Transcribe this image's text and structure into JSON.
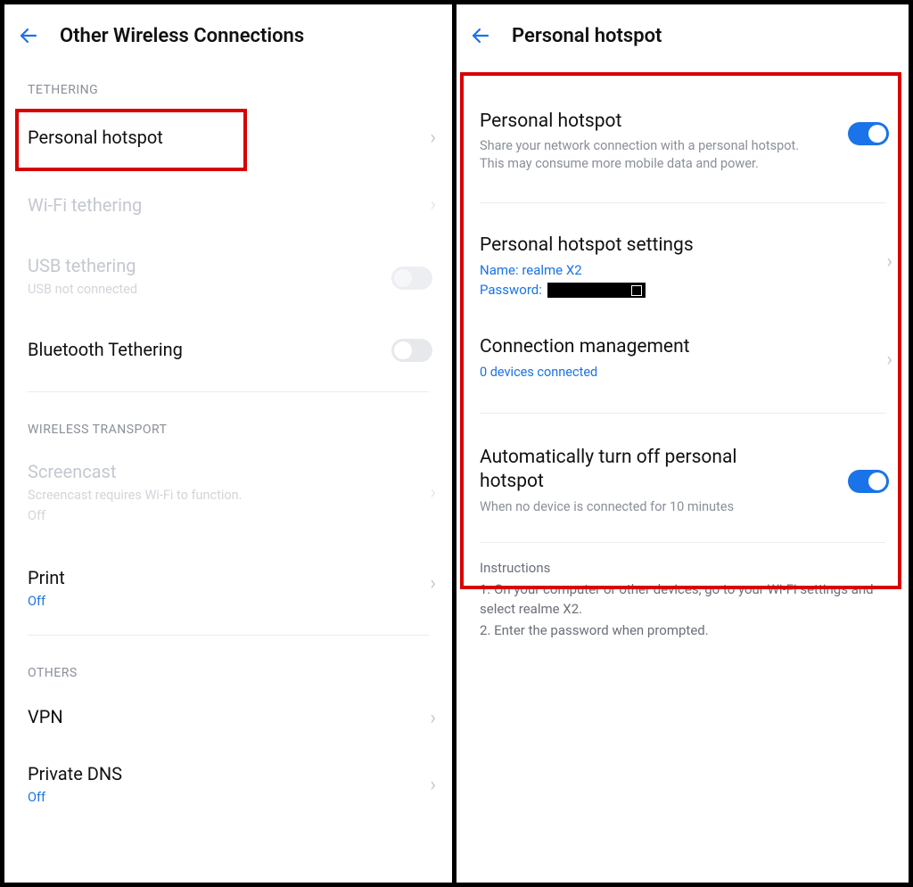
{
  "left": {
    "header": {
      "title": "Other Wireless Connections"
    },
    "sections": {
      "tethering": {
        "label": "TETHERING",
        "personal_hotspot": {
          "title": "Personal hotspot"
        },
        "wifi_tethering": {
          "title": "Wi-Fi tethering"
        },
        "usb_tethering": {
          "title": "USB tethering",
          "sub": "USB not connected"
        },
        "bt_tethering": {
          "title": "Bluetooth Tethering"
        }
      },
      "wireless_transport": {
        "label": "WIRELESS TRANSPORT",
        "screencast": {
          "title": "Screencast",
          "sub": "Screencast requires Wi-Fi to function.",
          "state": "Off"
        },
        "print": {
          "title": "Print",
          "state": "Off"
        }
      },
      "others": {
        "label": "OTHERS",
        "vpn": {
          "title": "VPN"
        },
        "private_dns": {
          "title": "Private DNS",
          "state": "Off"
        }
      }
    }
  },
  "right": {
    "header": {
      "title": "Personal hotspot"
    },
    "hotspot_toggle": {
      "title": "Personal hotspot",
      "desc": "Share your network connection with a personal hotspot. This may consume more mobile data and power.",
      "on": true
    },
    "settings": {
      "title": "Personal hotspot settings",
      "name_label": "Name: ",
      "name_value": "realme X2",
      "password_label": "Password: "
    },
    "conn_mgmt": {
      "title": "Connection management",
      "sub": "0 devices connected"
    },
    "auto_off": {
      "title": "Automatically turn off personal hotspot",
      "desc": "When no device is connected for 10 minutes",
      "on": true
    },
    "instructions": {
      "header": "Instructions",
      "line1": "1. On your computer or other devices, go to your Wi-Fi settings and select realme X2.",
      "line2": "2. Enter the password when prompted."
    }
  }
}
